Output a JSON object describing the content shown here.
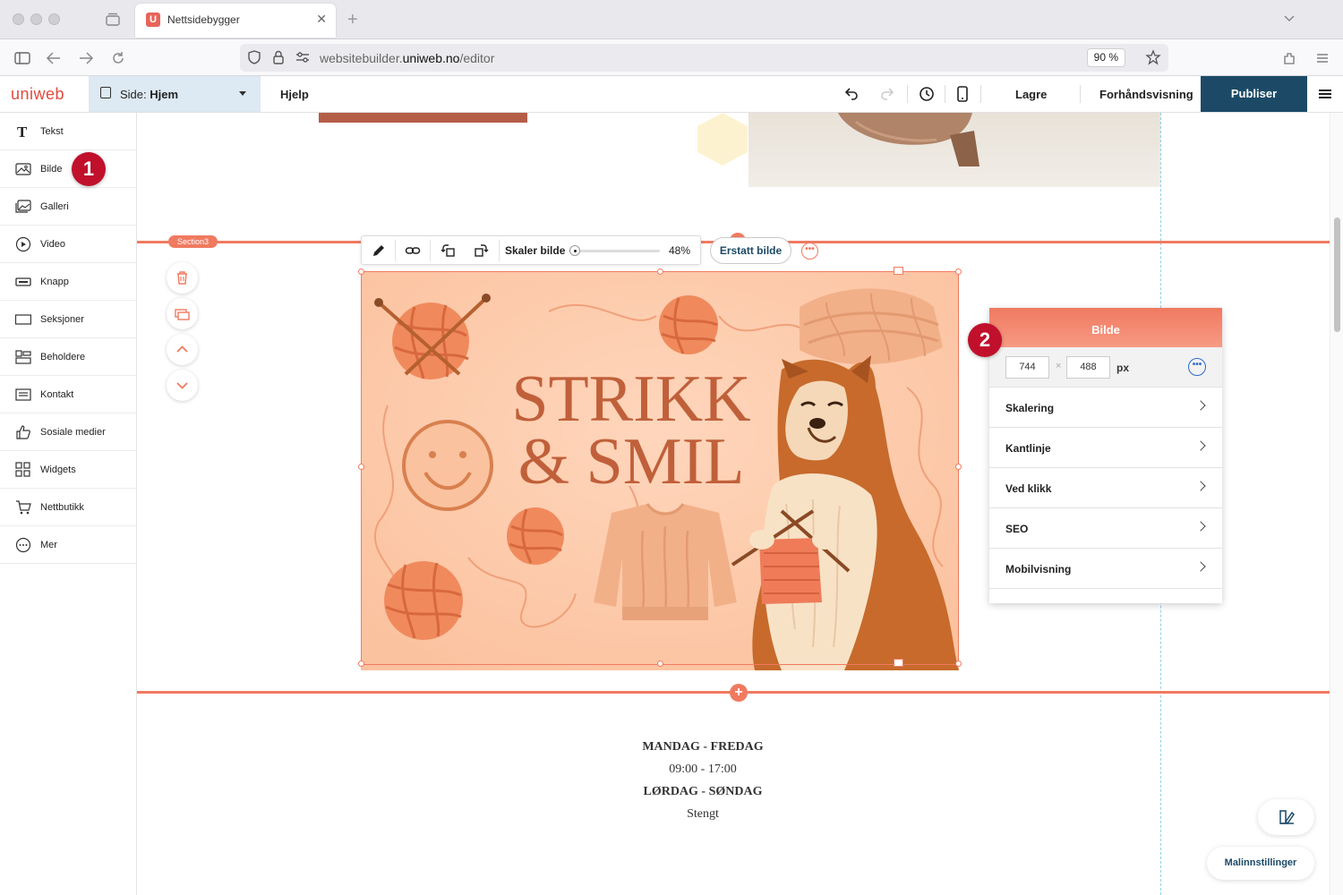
{
  "browser": {
    "tab_title": "Nettsidebygger",
    "favicon_letter": "U",
    "url_prefix": "websitebuilder.",
    "url_domain": "uniweb.no",
    "url_path": "/editor",
    "zoom": "90 %"
  },
  "editor": {
    "logo": "uniweb",
    "page_selector_prefix": "Side: ",
    "page_selector_value": "Hjem",
    "help": "Hjelp",
    "save": "Lagre",
    "preview": "Forhåndsvisning",
    "publish": "Publiser"
  },
  "sidebar": {
    "items": [
      {
        "label": "Tekst",
        "icon": "text-icon"
      },
      {
        "label": "Bilde",
        "icon": "image-icon"
      },
      {
        "label": "Galleri",
        "icon": "gallery-icon"
      },
      {
        "label": "Video",
        "icon": "video-icon"
      },
      {
        "label": "Knapp",
        "icon": "button-icon"
      },
      {
        "label": "Seksjoner",
        "icon": "section-icon"
      },
      {
        "label": "Beholdere",
        "icon": "container-icon"
      },
      {
        "label": "Kontakt",
        "icon": "contact-icon"
      },
      {
        "label": "Sosiale medier",
        "icon": "thumbs-up-icon"
      },
      {
        "label": "Widgets",
        "icon": "widgets-icon"
      },
      {
        "label": "Nettbutikk",
        "icon": "cart-icon"
      },
      {
        "label": "Mer",
        "icon": "more-icon"
      }
    ]
  },
  "section": {
    "tag": "Section3"
  },
  "image_toolbar": {
    "scale_label": "Skaler bilde",
    "scale_value": 48,
    "scale_percent": "48%",
    "replace_label": "Erstatt bilde"
  },
  "image": {
    "title_line1": "STRIKK",
    "title_line2": "& SMIL"
  },
  "panel": {
    "title": "Bilde",
    "width": "744",
    "height": "488",
    "unit": "px",
    "rows": [
      "Skalering",
      "Kantlinje",
      "Ved klikk",
      "SEO",
      "Mobilvisning"
    ]
  },
  "hours": {
    "line1": "MANDAG - FREDAG",
    "line2": "09:00 - 17:00",
    "line3": "LØRDAG - SØNDAG",
    "line4": "Stengt"
  },
  "markers": {
    "one": "1",
    "two": "2"
  },
  "template_settings": "Malinnstillinger",
  "colors": {
    "accent": "#f07a60",
    "primary": "#1c4a66",
    "marker": "#c0102c"
  }
}
